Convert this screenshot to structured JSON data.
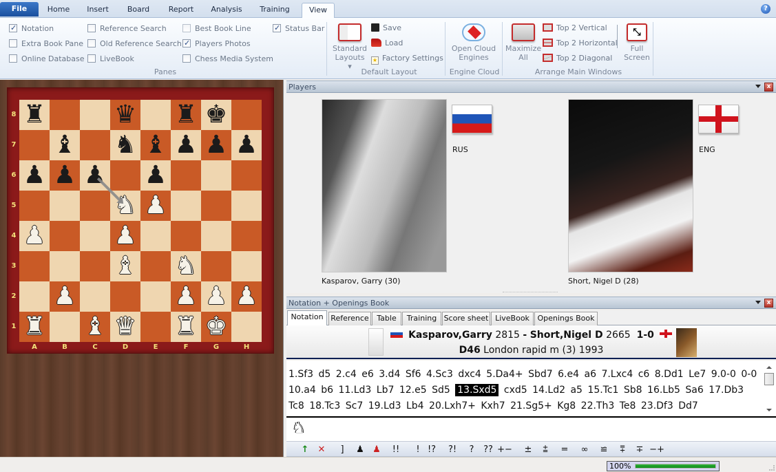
{
  "ribbon": {
    "tabs": [
      {
        "label": "File"
      },
      {
        "label": "Home"
      },
      {
        "label": "Insert"
      },
      {
        "label": "Board"
      },
      {
        "label": "Report"
      },
      {
        "label": "Analysis"
      },
      {
        "label": "Training"
      },
      {
        "label": "View",
        "active": true
      }
    ],
    "help_icon": "?",
    "panes_group": {
      "label": "Panes",
      "checkboxes": [
        {
          "label": "Notation",
          "checked": true
        },
        {
          "label": "Extra Book Pane",
          "checked": false
        },
        {
          "label": "Online Database",
          "checked": false
        },
        {
          "label": "Reference Search",
          "checked": false
        },
        {
          "label": "Old Reference Search",
          "checked": false
        },
        {
          "label": "LiveBook",
          "checked": false
        },
        {
          "label": "Best Book Line",
          "checked": false
        },
        {
          "label": "Players Photos",
          "checked": true
        },
        {
          "label": "Chess Media System",
          "checked": false
        },
        {
          "label": "Status Bar",
          "checked": true
        }
      ]
    },
    "default_layout_group": {
      "label": "Default Layout",
      "standard_layouts_line1": "Standard",
      "standard_layouts_line2": "Layouts",
      "save": "Save",
      "load": "Load",
      "factory_settings": "Factory Settings"
    },
    "engine_cloud_group": {
      "label": "Engine Cloud",
      "open_cloud_line1": "Open Cloud",
      "open_cloud_line2": "Engines"
    },
    "arrange_group": {
      "label": "Arrange Main Windows",
      "maximize_line1": "Maximize",
      "maximize_line2": "All",
      "top2_vertical": "Top 2 Vertical",
      "top2_horizontal": "Top 2 Horizontal",
      "top2_diagonal": "Top 2 Diagonal",
      "fullscreen_line1": "Full",
      "fullscreen_line2": "Screen"
    }
  },
  "board": {
    "ranks": [
      "8",
      "7",
      "6",
      "5",
      "4",
      "3",
      "2",
      "1"
    ],
    "files": [
      "A",
      "B",
      "C",
      "D",
      "E",
      "F",
      "G",
      "H"
    ],
    "position": [
      [
        "br",
        "",
        "",
        "bq",
        "",
        "br",
        "bk",
        ""
      ],
      [
        "",
        "bb",
        "",
        "bn",
        "bb",
        "bp",
        "bp",
        "bp"
      ],
      [
        "bp",
        "bp",
        "bp",
        "",
        "bp",
        "",
        "",
        ""
      ],
      [
        "",
        "",
        "",
        "wn",
        "wp",
        "",
        "",
        ""
      ],
      [
        "wp",
        "",
        "",
        "wp",
        "",
        "",
        "",
        ""
      ],
      [
        "",
        "",
        "",
        "wb",
        "",
        "wn",
        "",
        ""
      ],
      [
        "",
        "wp",
        "",
        "",
        "",
        "wp",
        "wp",
        "wp"
      ],
      [
        "wr",
        "",
        "wb",
        "wq",
        "",
        "wr",
        "wk",
        ""
      ]
    ],
    "last_move_arrow": {
      "from": "c6",
      "to": "d5"
    }
  },
  "players_pane": {
    "title": "Players",
    "white": {
      "name_label": "Kasparov, Garry  (30)",
      "country": "RUS"
    },
    "black": {
      "name_label": "Short, Nigel D  (28)",
      "country": "ENG"
    }
  },
  "notation_pane": {
    "title": "Notation + Openings Book",
    "tabs": [
      {
        "label": "Notation",
        "active": true
      },
      {
        "label": "Reference"
      },
      {
        "label": "Table"
      },
      {
        "label": "Training"
      },
      {
        "label": "Score sheet"
      },
      {
        "label": "LiveBook"
      },
      {
        "label": "Openings Book"
      }
    ],
    "game_header": {
      "white": "Kasparov,Garry",
      "white_elo": "2815",
      "separator": "-",
      "black": "Short,Nigel D",
      "black_elo": "2665",
      "result": "1-0",
      "eco": "D46",
      "event": "London rapid m (3) 1993"
    },
    "moves": [
      "1.Sf3",
      "d5",
      "2.c4",
      "e6",
      "3.d4",
      "Sf6",
      "4.Sc3",
      "dxc4",
      "5.Da4+",
      "Sbd7",
      "6.e4",
      "a6",
      "7.Lxc4",
      "c6",
      "8.Dd1",
      "Le7",
      "9.0-0",
      "0-0",
      "10.a4",
      "b6",
      "11.Ld3",
      "Lb7",
      "12.e5",
      "Sd5",
      "13.Sxd5",
      "cxd5",
      "14.Ld2",
      "a5",
      "15.Tc1",
      "Sb8",
      "16.Lb5",
      "Sa6",
      "17.Db3",
      "Tc8",
      "18.Tc3",
      "Sc7",
      "19.Ld3",
      "Lb4",
      "20.Lxh7+",
      "Kxh7",
      "21.Sg5+",
      "Kg8",
      "22.Th3",
      "Te8",
      "23.Df3",
      "Dd7"
    ],
    "current_move": "13.Sxd5",
    "annotation_symbols": [
      "!!",
      "!",
      "!?",
      "?!",
      "?",
      "??",
      "+−",
      "±",
      "⩲",
      "=",
      "∞",
      "⩱̶",
      "∓",
      "∓",
      "−+"
    ]
  },
  "annotation_bar": {
    "buttons": [
      {
        "name": "promote-variation-icon",
        "glyph": "↑"
      },
      {
        "name": "delete-variation-icon",
        "glyph": "✕"
      },
      {
        "name": "close-bracket-icon",
        "glyph": "]"
      },
      {
        "name": "black-pawn-icon",
        "glyph": "♟"
      },
      {
        "name": "red-pawn-icon",
        "glyph": "♟"
      },
      {
        "name": "ann-double-exclaim",
        "glyph": "!!"
      },
      {
        "name": "ann-exclaim",
        "glyph": "!"
      },
      {
        "name": "ann-exclaim-question",
        "glyph": "!?"
      },
      {
        "name": "ann-question-exclaim",
        "glyph": "?!"
      },
      {
        "name": "ann-question",
        "glyph": "?"
      },
      {
        "name": "ann-double-question",
        "glyph": "??"
      },
      {
        "name": "ann-white-winning",
        "glyph": "+−"
      },
      {
        "name": "ann-white-better",
        "glyph": "±"
      },
      {
        "name": "ann-white-slightly-better",
        "glyph": "⩲"
      },
      {
        "name": "ann-equal",
        "glyph": "="
      },
      {
        "name": "ann-unclear",
        "glyph": "∞"
      },
      {
        "name": "ann-compensation",
        "glyph": "≌"
      },
      {
        "name": "ann-black-slightly-better",
        "glyph": "⩱"
      },
      {
        "name": "ann-black-better",
        "glyph": "∓"
      },
      {
        "name": "ann-black-winning",
        "glyph": "−+"
      }
    ]
  },
  "status_bar": {
    "zoom_label": "100%",
    "zoom_progress": 1.0
  },
  "colors": {
    "accent_blue": "#1a4f9e",
    "board_light": "#efd6b0",
    "board_dark": "#c95a26",
    "board_frame": "#8b1a1a",
    "coord_color": "#f4e27a",
    "progress_green": "#1a9a28"
  }
}
